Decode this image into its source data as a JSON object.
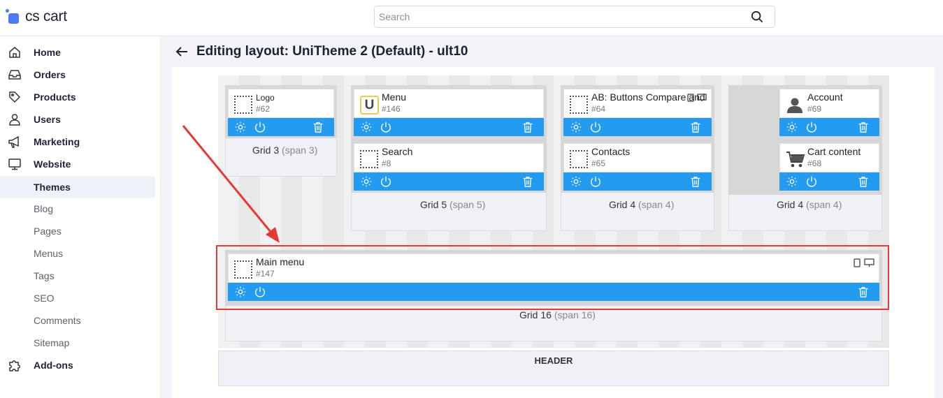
{
  "app": {
    "logo_text": "cs cart",
    "brand_color": "#4b7cf3"
  },
  "search": {
    "placeholder": "Search",
    "value": ""
  },
  "sidebar": {
    "items": [
      {
        "label": "Home",
        "icon": "home-icon"
      },
      {
        "label": "Orders",
        "icon": "inbox-icon"
      },
      {
        "label": "Products",
        "icon": "tag-icon"
      },
      {
        "label": "Users",
        "icon": "user-icon"
      },
      {
        "label": "Marketing",
        "icon": "megaphone-icon"
      },
      {
        "label": "Website",
        "icon": "monitor-icon"
      },
      {
        "label": "Themes",
        "active": true
      },
      {
        "label": "Blog"
      },
      {
        "label": "Pages"
      },
      {
        "label": "Menus"
      },
      {
        "label": "Tags"
      },
      {
        "label": "SEO"
      },
      {
        "label": "Comments"
      },
      {
        "label": "Sitemap"
      },
      {
        "label": "Add-ons",
        "icon": "puzzle-icon"
      }
    ]
  },
  "page": {
    "title": "Editing layout: UniTheme 2 (Default) - ult10"
  },
  "grids": {
    "grid3": {
      "label": "Grid 3",
      "span": "(span 3)"
    },
    "grid5": {
      "label": "Grid 5",
      "span": "(span 5)"
    },
    "grid4a": {
      "label": "Grid 4",
      "span": "(span 4)"
    },
    "grid4b": {
      "label": "Grid 4",
      "span": "(span 4)"
    },
    "grid16": {
      "label": "Grid 16",
      "span": "(span 16)"
    }
  },
  "blocks": {
    "logo": {
      "name": "Logo",
      "id": "#62"
    },
    "menu": {
      "name": "Menu",
      "id": "#146",
      "icon_letter": "U"
    },
    "search": {
      "name": "Search",
      "id": "#8"
    },
    "ab": {
      "name": "AB: Buttons Compare and",
      "id": "#64"
    },
    "contacts": {
      "name": "Contacts",
      "id": "#65"
    },
    "account": {
      "name": "Account",
      "id": "#69"
    },
    "cart": {
      "name": "Cart content",
      "id": "#68"
    },
    "main_menu": {
      "name": "Main menu",
      "id": "#147"
    }
  },
  "header_section": {
    "label": "HEADER"
  },
  "colors": {
    "toolbar": "#229bf0",
    "highlight": "#e53935"
  }
}
